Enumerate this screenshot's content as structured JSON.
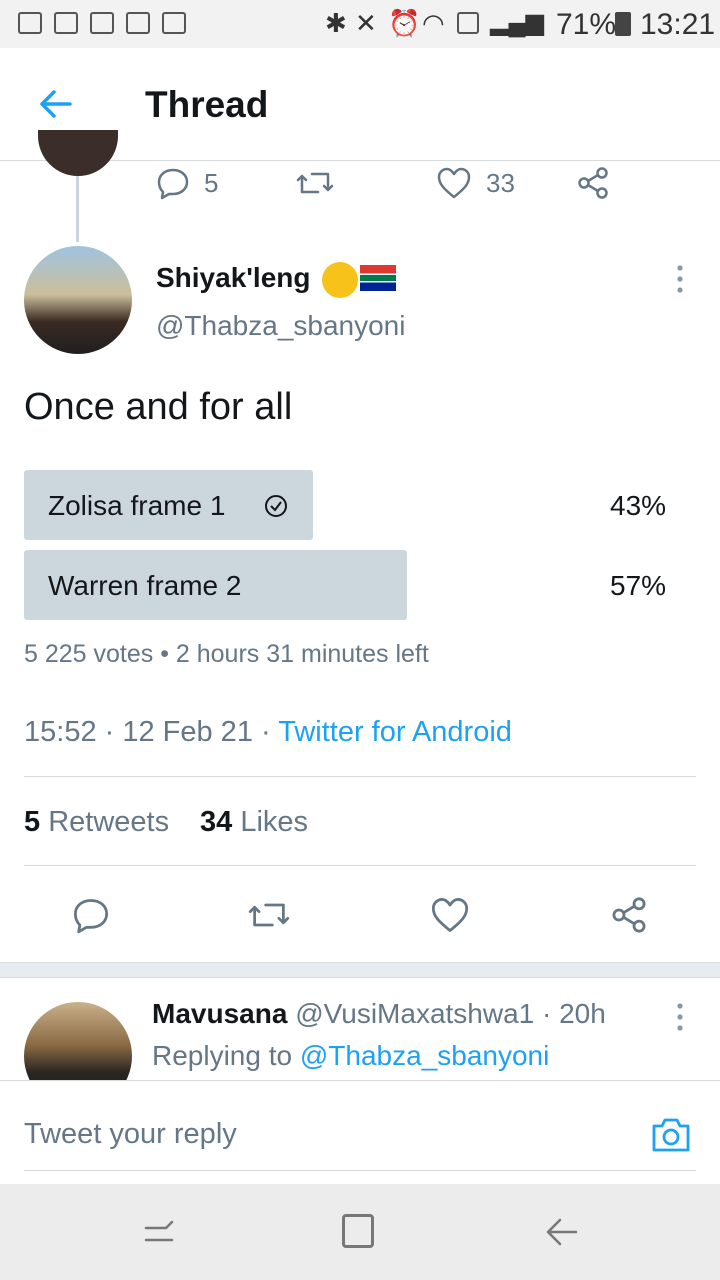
{
  "status_bar": {
    "battery": "71%",
    "time": "13:21"
  },
  "header": {
    "title": "Thread"
  },
  "parent_tweet_actions": {
    "replies": "5",
    "likes": "33"
  },
  "tweet": {
    "display_name": "Shiyak'leng",
    "handle": "@Thabza_sbanyoni",
    "text": "Once and for all",
    "poll": {
      "options": [
        {
          "label": "Zolisa frame 1",
          "percent": "43%",
          "fraction": 0.43,
          "selected": true
        },
        {
          "label": "Warren frame 2",
          "percent": "57%",
          "fraction": 0.57,
          "selected": false
        }
      ],
      "meta": "5 225 votes • 2 hours 31 minutes left"
    },
    "timestamp": "15:52 · 12 Feb 21 · ",
    "source": "Twitter for Android",
    "retweets_count": "5",
    "retweets_label": "Retweets",
    "likes_count": "34",
    "likes_label": "Likes"
  },
  "reply": {
    "display_name": "Mavusana",
    "handle_time": "@VusiMaxatshwa1 · 20h",
    "replying_prefix": "Replying to ",
    "replying_to": "@Thabza_sbanyoni"
  },
  "composer": {
    "placeholder": "Tweet your reply"
  },
  "colors": {
    "accent": "#1da1f2",
    "muted": "#657786",
    "poll_bar": "#ccd6dd"
  }
}
